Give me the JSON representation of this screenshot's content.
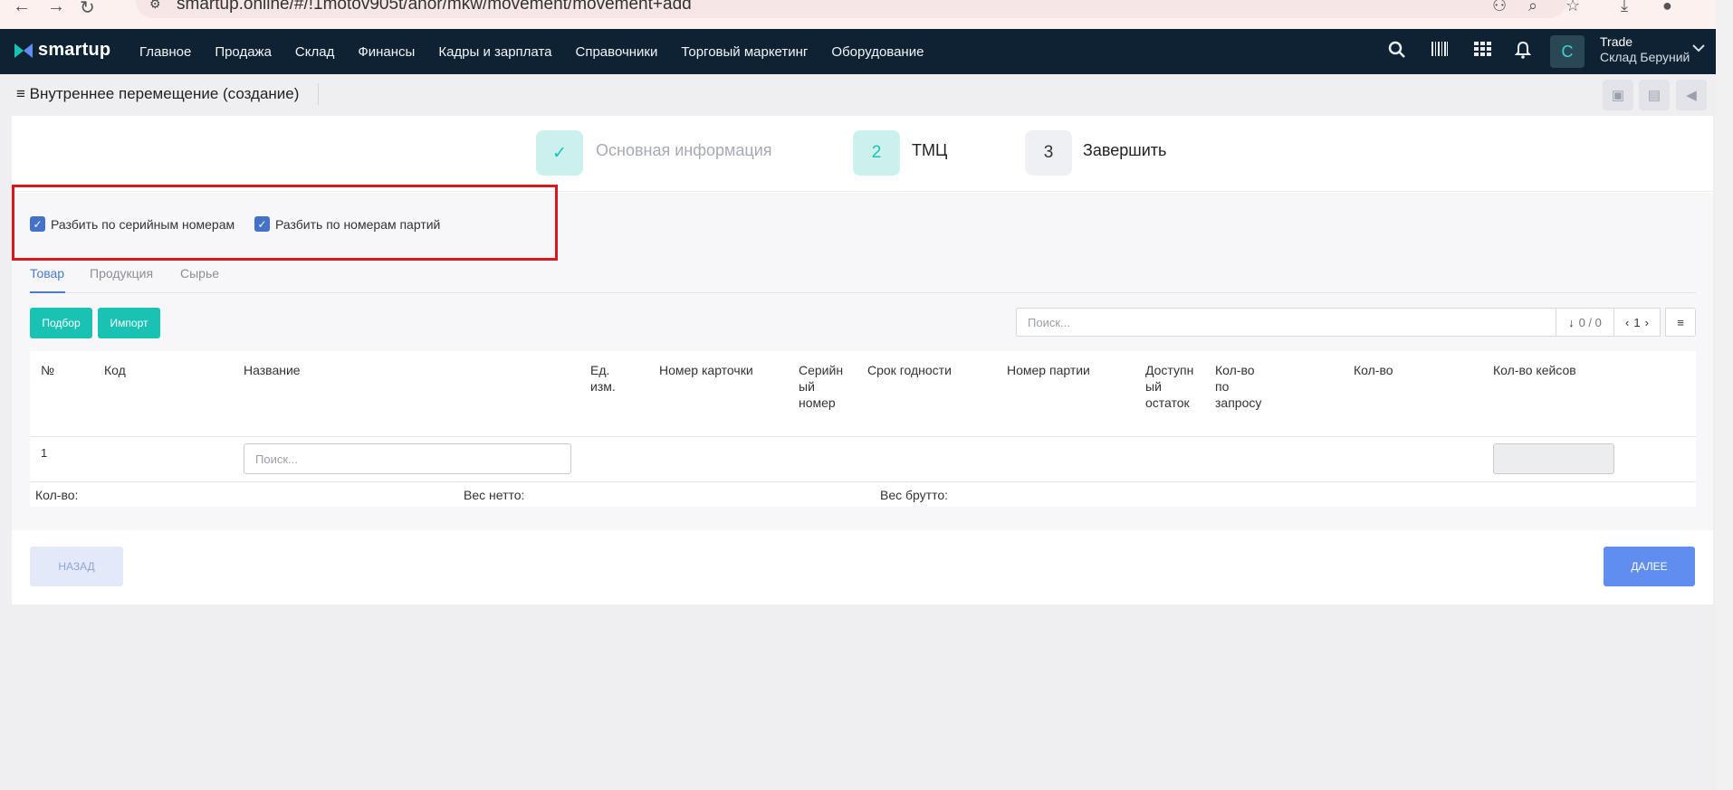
{
  "browser": {
    "url": "smartup.online/#/!1motov905t/anor/mkw/movement/movement+add"
  },
  "topnav": {
    "logo_text": "smartup",
    "items": [
      "Главное",
      "Продажа",
      "Склад",
      "Финансы",
      "Кадры и зарплата",
      "Справочники",
      "Торговый маркетинг",
      "Оборудование"
    ],
    "avatar_letter": "C",
    "user_name": "Trade",
    "user_warehouse": "Склад Беруний",
    "icons": [
      "search-icon",
      "barcode-icon",
      "apps-grid-icon",
      "bell-icon"
    ]
  },
  "page": {
    "title": "Внутреннее перемещение (создание)",
    "header_icons": [
      "calendar-icon",
      "id-card-icon",
      "megaphone-icon"
    ]
  },
  "stepper": {
    "steps": [
      {
        "badge": "✓",
        "label": "Основная информация",
        "state": "done"
      },
      {
        "badge": "2",
        "label": "ТМЦ",
        "state": "active"
      },
      {
        "badge": "3",
        "label": "Завершить",
        "state": "pending"
      }
    ]
  },
  "options": {
    "split_serial": "Разбить по серийным номерам",
    "split_serial_checked": true,
    "split_batch": "Разбить по номерам партий",
    "split_batch_checked": true
  },
  "tabs": [
    "Товар",
    "Продукция",
    "Сырье"
  ],
  "toolbar": {
    "pick_label": "Подбор",
    "import_label": "Импорт",
    "search_placeholder": "Поиск...",
    "counter": "0 / 0",
    "page": "1"
  },
  "table": {
    "columns": [
      "№",
      "Код",
      "Название",
      "Ед. изм.",
      "Номер карточки",
      "Серийн ый номер",
      "Срок годности",
      "Номер партии",
      "Доступн ый остаток",
      "Кол-во по запросу",
      "Кол-во",
      "Кол-во кейсов"
    ],
    "rows": [
      {
        "num": "1",
        "name_placeholder": "Поиск..."
      }
    ],
    "footer": {
      "qty_label": "Кол-во:",
      "net_label": "Вес нетто:",
      "gross_label": "Вес брутто:"
    }
  },
  "actions": {
    "back_label": "НАЗАД",
    "next_label": "ДАЛЕЕ"
  },
  "colors": {
    "nav_bg": "#0f2233",
    "teal": "#1ac2b4",
    "primary": "#5f8ef0",
    "highlight": "#d8181e"
  }
}
